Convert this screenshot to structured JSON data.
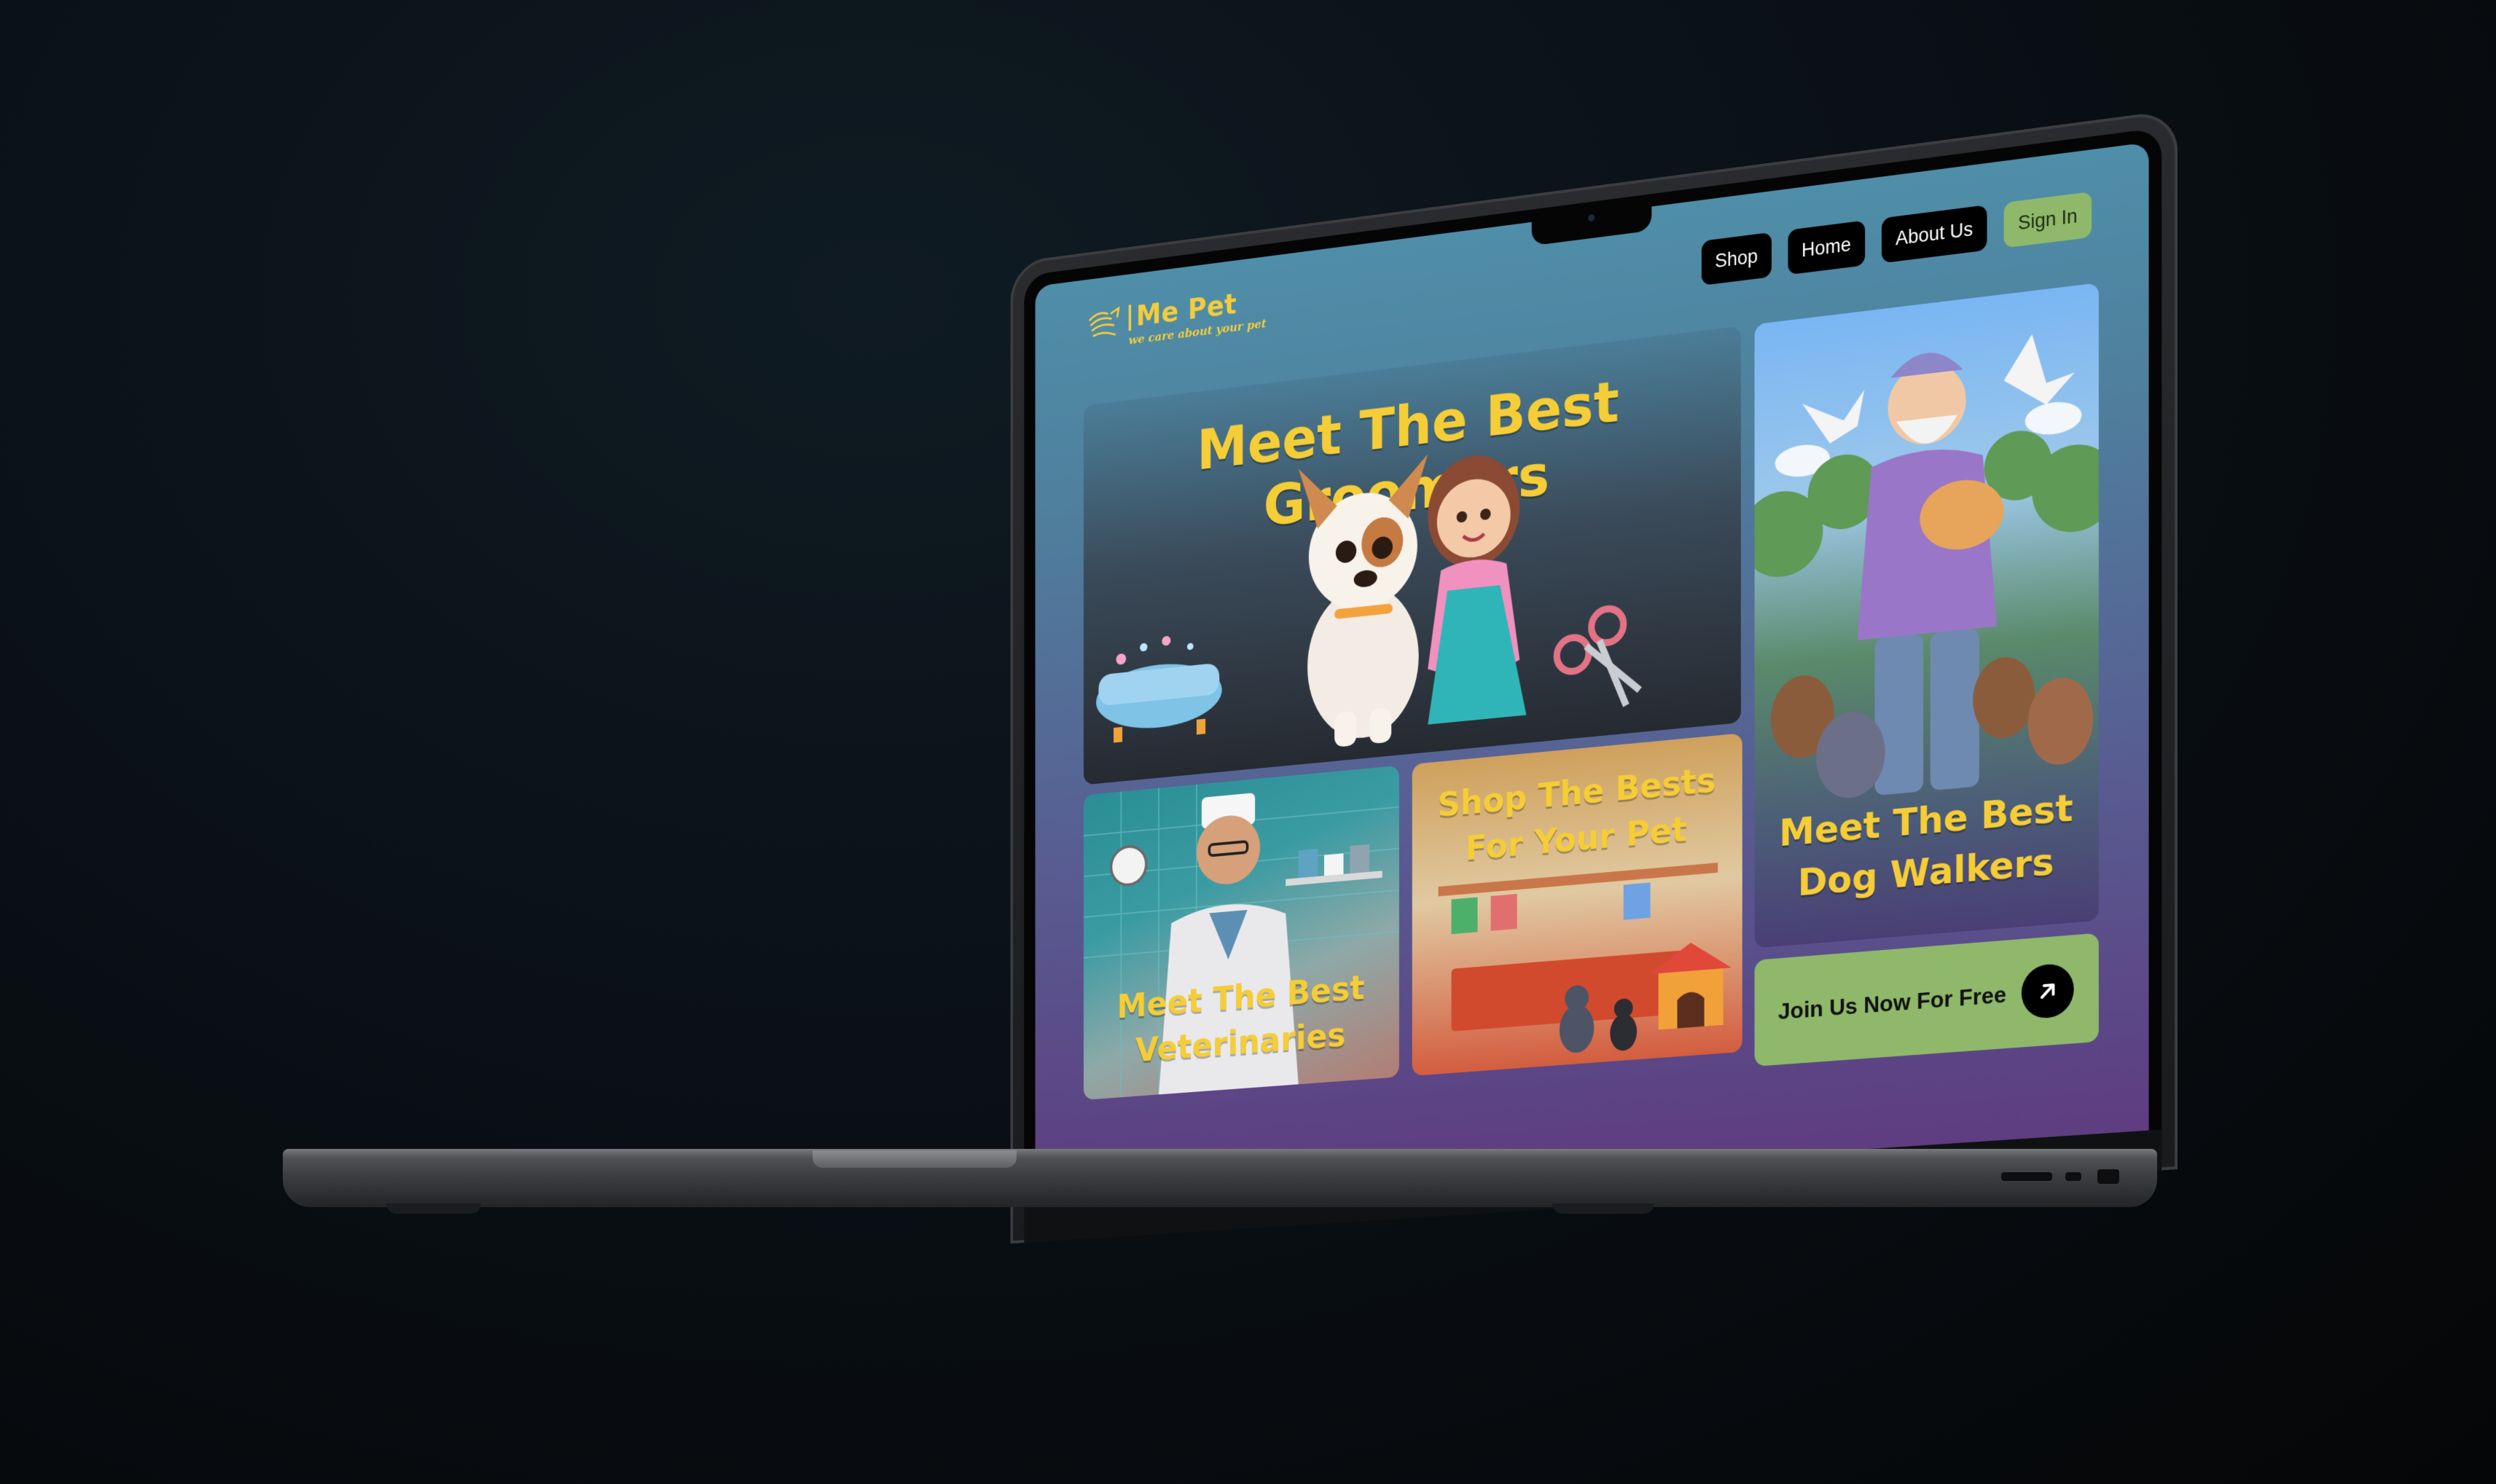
{
  "site": {
    "brand": "Me Pet",
    "tagline": "we care about your pet"
  },
  "nav": {
    "items": [
      {
        "label": "Shop"
      },
      {
        "label": "Home"
      },
      {
        "label": "About Us"
      }
    ],
    "signin_label": "Sign In"
  },
  "cards": {
    "groomers": "Meet The Best Groomers",
    "walkers_line1": "Meet The Best",
    "walkers_line2": "Dog Walkers",
    "vets_line1": "Meet The Best",
    "vets_line2": "Veterinaries",
    "shop_line1": "Shop The Bests",
    "shop_line2": "For Your Pet"
  },
  "cta": {
    "label": "Join Us Now For Free",
    "icon": "arrow-up-right-icon"
  },
  "colors": {
    "accent_yellow": "#f5cd36",
    "button_green": "#8fb86a",
    "nav_black": "#000000"
  }
}
